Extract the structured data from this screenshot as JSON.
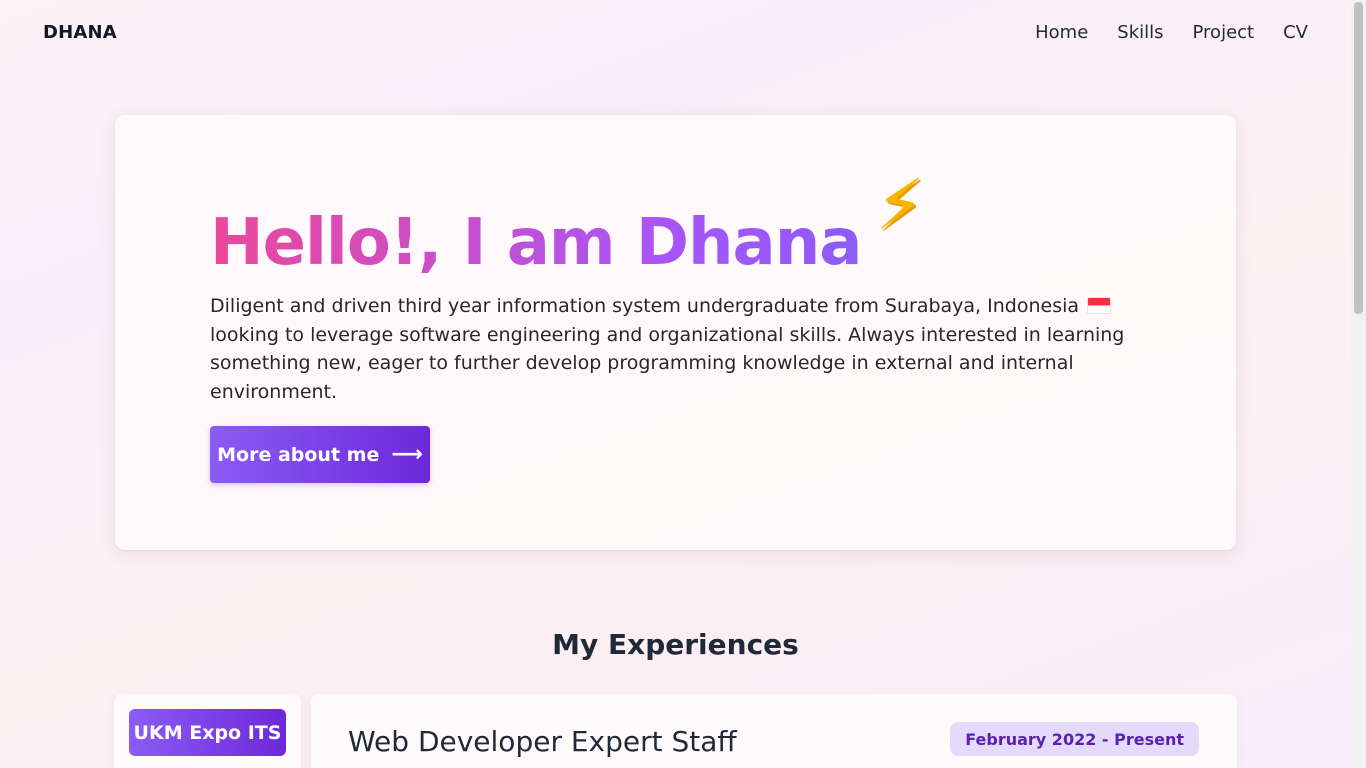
{
  "nav": {
    "brand": "DHANA",
    "links": [
      "Home",
      "Skills",
      "Project",
      "CV"
    ]
  },
  "hero": {
    "title": "Hello!, I am Dhana",
    "emoji": "⚡",
    "emoji_icon": "lightning-bolt-icon",
    "flag_icon": "indonesia-flag-icon",
    "description_before_flag": "Diligent and driven third year information system undergraduate from Surabaya, Indonesia",
    "description_after_flag": "looking to leverage software engineering and organizational skills. Always interested in learning something new, eager to further develop programming knowledge in external and internal environment.",
    "button_label": "More about me",
    "button_icon": "arrow-right-icon",
    "gradient_colors": [
      "#ec4899",
      "#a855f7",
      "#8b5cf6"
    ]
  },
  "experiences": {
    "title": "My Experiences",
    "organization": "UKM Expo ITS",
    "role": "Web Developer Expert Staff",
    "period": "February 2022 - Present"
  },
  "colors": {
    "accent": "#7c3aed",
    "badge_bg": "#e4dafb",
    "badge_text": "#5b21b6"
  }
}
